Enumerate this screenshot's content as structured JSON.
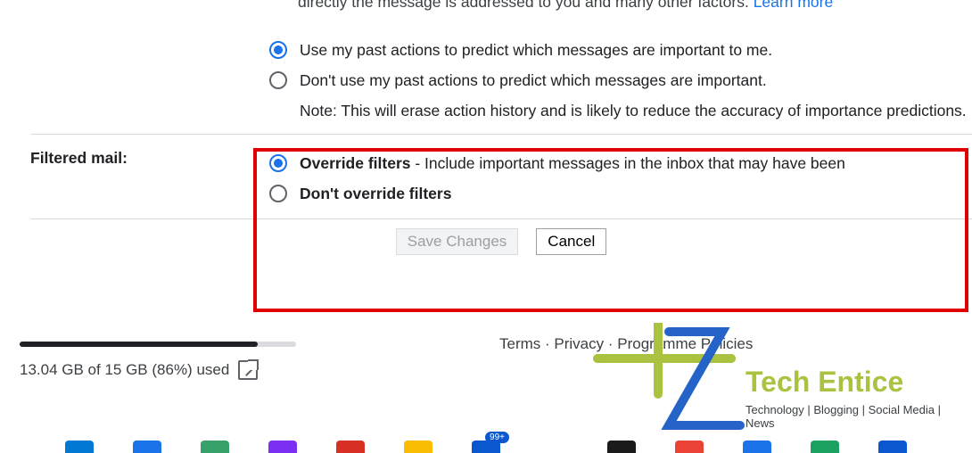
{
  "top_cutoff": {
    "text": "directly the message is addressed to you and many other factors.",
    "learn_more": "Learn more"
  },
  "importance": {
    "opt1": "Use my past actions to predict which messages are important to me.",
    "opt2": "Don't use my past actions to predict which messages are important.",
    "note": "Note: This will erase action history and is likely to reduce the accuracy of importance predictions.",
    "selected": 1
  },
  "filtered_mail": {
    "label": "Filtered mail:",
    "opt1_bold": "Override filters",
    "opt1_rest": " - Include important messages in the inbox that may have been",
    "opt2_bold": "Don't override filters",
    "selected": 1
  },
  "buttons": {
    "save": "Save Changes",
    "cancel": "Cancel"
  },
  "storage": {
    "percent_fill": 86,
    "text": "13.04 GB of 15 GB (86%) used"
  },
  "footer": {
    "terms": "Terms",
    "privacy": "Privacy",
    "policies": "Programme Policies"
  },
  "watermark": {
    "brand": "Tech Entice",
    "tagline": "Technology | Blogging | Social Media | News"
  },
  "taskbar_badge": "99+",
  "colors": {
    "t1": "#0078d4",
    "t2": "#1a73e8",
    "t3": "#38a169",
    "t4": "#7b2ff2",
    "t5": "#d93025",
    "t6": "#fbbc04",
    "t7": "#0b57d0",
    "t8": "#fff",
    "t9": "#1a1a1a",
    "t10": "#ea4335",
    "t11": "#1a73e8",
    "t12": "#1ba260",
    "t13": "#0b57d0"
  }
}
